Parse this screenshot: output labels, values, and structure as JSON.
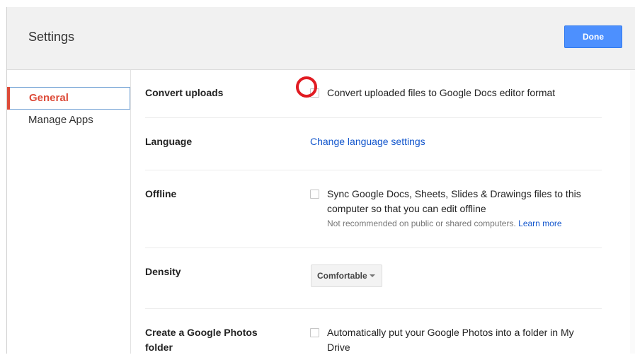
{
  "dialog": {
    "title": "Settings",
    "done_label": "Done"
  },
  "sidebar": {
    "items": [
      {
        "label": "General",
        "selected": true
      },
      {
        "label": "Manage Apps",
        "selected": false
      }
    ]
  },
  "settings": {
    "convert": {
      "label": "Convert uploads",
      "checkbox_text": "Convert uploaded files to Google Docs editor format",
      "checked": false
    },
    "language": {
      "label": "Language",
      "link_text": "Change language settings"
    },
    "offline": {
      "label": "Offline",
      "checkbox_line1": "Sync Google Docs, Sheets, Slides & Drawings files to this",
      "checkbox_line2": "computer so that you can edit offline",
      "hint": "Not recommended on public or shared computers.",
      "hint_link": "Learn more",
      "checked": false
    },
    "density": {
      "label": "Density",
      "value": "Comfortable"
    },
    "photos": {
      "label_line1": "Create a Google Photos",
      "label_line2": "folder",
      "checkbox_line1": "Automatically put your Google Photos into a folder in My",
      "checkbox_line2": "Drive",
      "checked": false
    }
  },
  "colors": {
    "accent_blue": "#4d90fe",
    "selected_red": "#dd4b39",
    "link_blue": "#1155cc",
    "highlight_ring": "#e11b22"
  }
}
